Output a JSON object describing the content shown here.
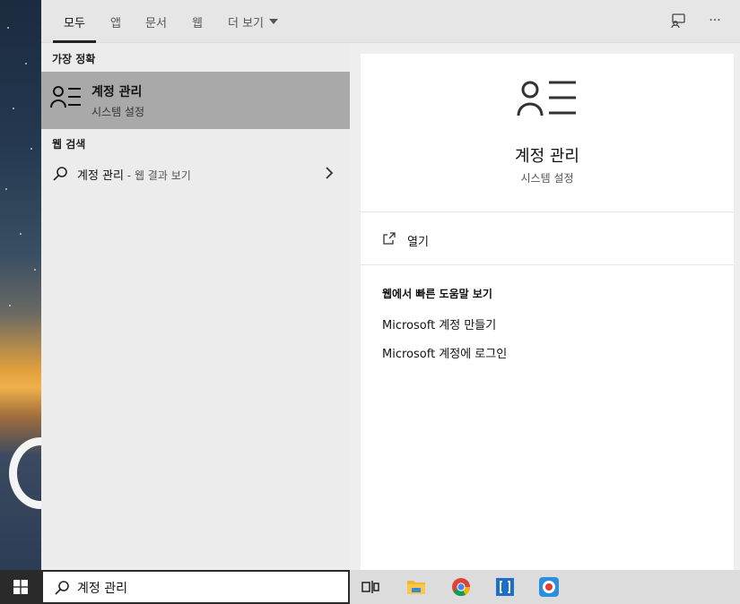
{
  "tabs": [
    {
      "label": "모두",
      "active": true
    },
    {
      "label": "앱"
    },
    {
      "label": "문서"
    },
    {
      "label": "웹"
    },
    {
      "label": "더 보기"
    }
  ],
  "top_icons": {
    "feedback": "feedback-icon",
    "more": "···"
  },
  "left": {
    "best_match_heading": "가장 정확",
    "best_match": {
      "title": "계정 관리",
      "subtitle": "시스템 설정",
      "icon": "account-list-icon"
    },
    "web_heading": "웹 검색",
    "web_result": {
      "query": "계정 관리",
      "suffix": " - 웹 결과 보기"
    }
  },
  "right": {
    "title": "계정 관리",
    "subtitle": "시스템 설정",
    "open_label": "열기",
    "help_heading": "웹에서 빠른 도움말 보기",
    "help_links": [
      "Microsoft 계정 만들기",
      "Microsoft 계정에 로그인"
    ]
  },
  "taskbar": {
    "search_value": "계정 관리",
    "apps": [
      "task-view-icon",
      "file-explorer-icon",
      "chrome-icon",
      "app-bracket-icon",
      "app-record-icon"
    ]
  },
  "colors": {
    "selected_bg": "#a9a9a9",
    "panel_bg": "#ececec",
    "chrome_red": "#db4437",
    "chrome_yellow": "#f4b400",
    "chrome_green": "#0f9d58",
    "chrome_blue": "#4285f4",
    "accent_blue": "#0a6fd6"
  }
}
